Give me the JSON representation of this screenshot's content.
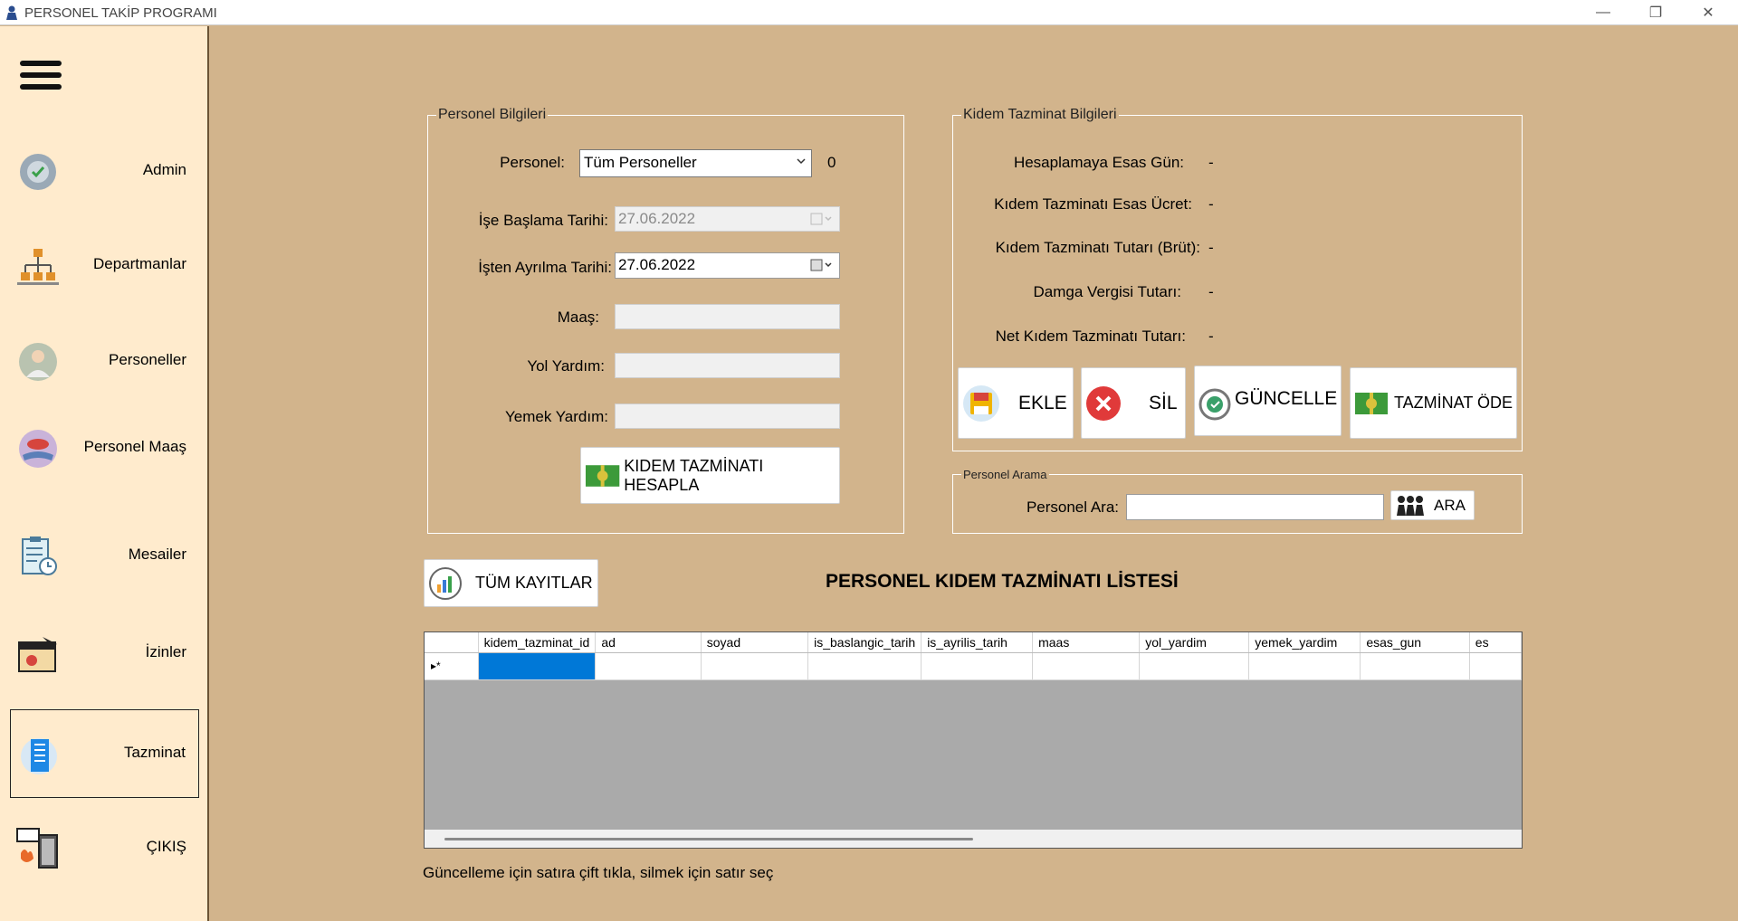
{
  "window": {
    "title": "PERSONEL TAKİP PROGRAMI",
    "minimize_glyph": "—",
    "maximize_glyph": "❐",
    "close_glyph": "✕"
  },
  "sidebar": {
    "items": [
      {
        "label": "Admin",
        "icon": "admin-badge-icon"
      },
      {
        "label": "Departmanlar",
        "icon": "org-chart-icon"
      },
      {
        "label": "Personeller",
        "icon": "staff-icon"
      },
      {
        "label": "Personel Maaş",
        "icon": "salary-hand-icon"
      },
      {
        "label": "Mesailer",
        "icon": "clipboard-clock-icon"
      },
      {
        "label": "İzinler",
        "icon": "calendar-plane-icon"
      },
      {
        "label": "Tazminat",
        "icon": "building-icon"
      },
      {
        "label": "ÇIKIŞ",
        "icon": "exit-door-icon"
      }
    ],
    "active_item": "Tazminat"
  },
  "personel_bilgileri": {
    "legend": "Personel Bilgileri",
    "personel_label": "Personel:",
    "personel_value": "Tüm Personeller",
    "personel_count": "0",
    "ise_baslama_label": "İşe Başlama Tarihi:",
    "ise_baslama_value": "27.06.2022",
    "isten_ayrilma_label": "İşten Ayrılma Tarihi:",
    "isten_ayrilma_value": "27.06.2022",
    "maas_label": "Maaş:",
    "yol_label": "Yol Yardım:",
    "yemek_label": "Yemek Yardım:",
    "hesapla_button": "KIDEM TAZMİNATI HESAPLA"
  },
  "kidem_bilgileri": {
    "legend": "Kidem Tazminat Bilgileri",
    "rows": [
      {
        "label": "Hesaplamaya Esas Gün:",
        "value": "-"
      },
      {
        "label": "Kıdem Tazminatı Esas Ücret:",
        "value": "-"
      },
      {
        "label": "Kıdem Tazminatı Tutarı (Brüt):",
        "value": "-"
      },
      {
        "label": "Damga Vergisi Tutarı:",
        "value": "-"
      },
      {
        "label": "Net Kıdem Tazminatı Tutarı:",
        "value": "-"
      }
    ],
    "buttons": {
      "ekle": "EKLE",
      "sil": "SİL",
      "guncelle": "GÜNCELLE",
      "tazminat_ode": "TAZMİNAT ÖDE"
    }
  },
  "personel_arama": {
    "legend": "Personel Arama",
    "label": "Personel Ara:",
    "value": "",
    "button": "ARA"
  },
  "tum_kayitlar_button": "TÜM KAYITLAR",
  "list_title": "PERSONEL KIDEM TAZMİNATI LİSTESİ",
  "grid": {
    "columns": [
      "kidem_tazminat_id",
      "ad",
      "soyad",
      "is_baslangic_tarih",
      "is_ayrilis_tarih",
      "maas",
      "yol_yardim",
      "yemek_yardim",
      "esas_gun",
      "es"
    ],
    "new_row_marker": "▸*",
    "colors": {
      "selection": "#0078d7",
      "empty_area": "#aaaaaa"
    }
  },
  "hint": "Güncelleme için satıra çift tıkla, silmek için satır seç",
  "colors": {
    "background": "#d2b48c",
    "sidebar": "#ffebcd"
  }
}
